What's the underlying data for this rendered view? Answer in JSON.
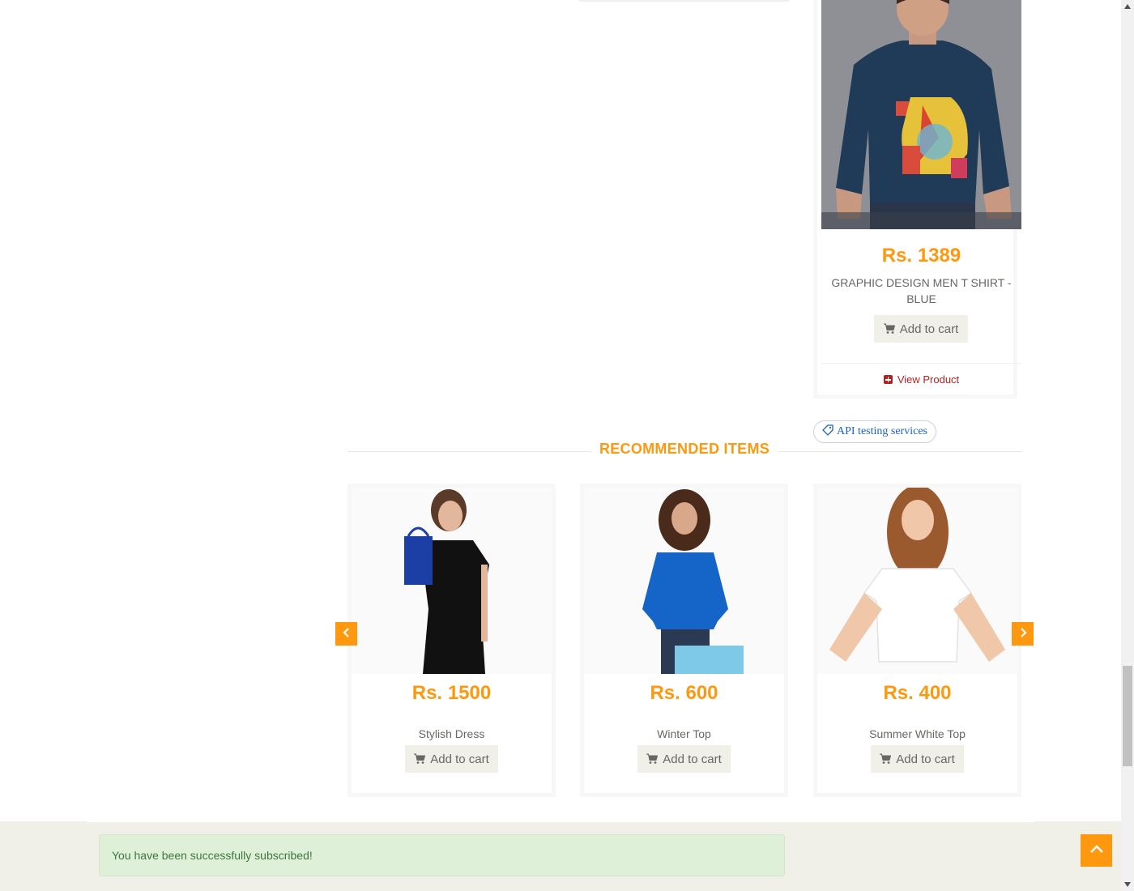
{
  "featured_product": {
    "price": "Rs. 1389",
    "name": "GRAPHIC DESIGN MEN T SHIRT - BLUE",
    "add_to_cart": "Add to cart",
    "view_product": "View Product"
  },
  "tag": {
    "label": "API testing services"
  },
  "recommended": {
    "title": "RECOMMENDED ITEMS",
    "items": [
      {
        "price": "Rs. 1500",
        "name": "Stylish Dress",
        "add_to_cart": "Add to cart"
      },
      {
        "price": "Rs. 600",
        "name": "Winter Top",
        "add_to_cart": "Add to cart"
      },
      {
        "price": "Rs. 400",
        "name": "Summer White Top",
        "add_to_cart": "Add to cart"
      }
    ]
  },
  "subscription": {
    "message": "You have been successfully subscribed!"
  },
  "colors": {
    "accent": "#FE980F",
    "success_bg": "#dff0d8",
    "success_text": "#3c763d",
    "footer_bg": "#F0F0E9"
  },
  "icons": {
    "cart": "shopping-cart-icon",
    "plus": "plus-square-icon",
    "tag": "tag-icon",
    "prev": "chevron-left-icon",
    "next": "chevron-right-icon",
    "scroll_up": "chevron-up-icon"
  }
}
